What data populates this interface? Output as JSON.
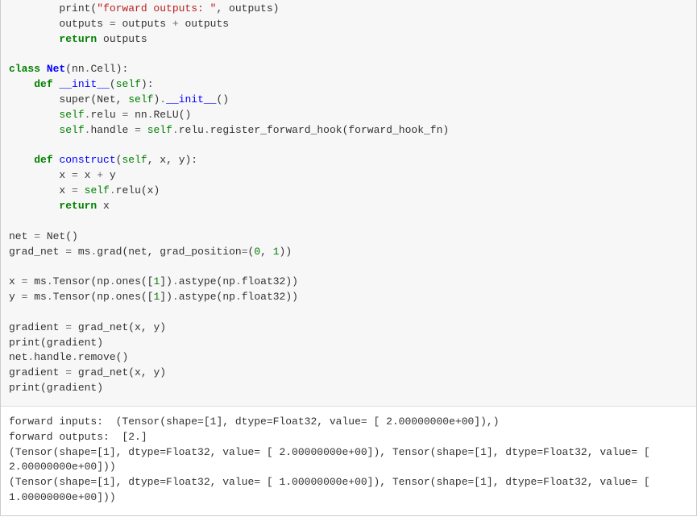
{
  "code": {
    "l0a": "        print(",
    "l0s": "\"forward outputs: \"",
    "l0b": ", outputs)",
    "l1a": "        outputs ",
    "l1op": "=",
    "l1b": " outputs ",
    "l1op2": "+",
    "l1c": " outputs",
    "l2a": "        ",
    "l2kw": "return",
    "l2b": " outputs",
    "l4kw": "class",
    "l4sp": " ",
    "l4cls": "Net",
    "l4a": "(nn",
    "l4op": ".",
    "l4b": "Cell):",
    "l5a": "    ",
    "l5kw": "def",
    "l5sp": " ",
    "l5fn": "__init__",
    "l5b": "(",
    "l5self": "self",
    "l5c": "):",
    "l6a": "        super(Net, ",
    "l6self": "self",
    "l6b": ")",
    "l6op": ".",
    "l6fn": "__init__",
    "l6c": "()",
    "l7a": "        ",
    "l7self": "self",
    "l7op": ".",
    "l7b": "relu ",
    "l7op2": "=",
    "l7c": " nn",
    "l7op3": ".",
    "l7d": "ReLU()",
    "l8a": "        ",
    "l8self": "self",
    "l8op": ".",
    "l8b": "handle ",
    "l8op2": "=",
    "l8c": " ",
    "l8self2": "self",
    "l8op3": ".",
    "l8d": "relu",
    "l8op4": ".",
    "l8e": "register_forward_hook(forward_hook_fn)",
    "l10a": "    ",
    "l10kw": "def",
    "l10sp": " ",
    "l10fn": "construct",
    "l10b": "(",
    "l10self": "self",
    "l10c": ", x, y):",
    "l11a": "        x ",
    "l11op": "=",
    "l11b": " x ",
    "l11op2": "+",
    "l11c": " y",
    "l12a": "        x ",
    "l12op": "=",
    "l12b": " ",
    "l12self": "self",
    "l12op2": ".",
    "l12c": "relu(x)",
    "l13a": "        ",
    "l13kw": "return",
    "l13b": " x",
    "l15a": "net ",
    "l15op": "=",
    "l15b": " Net()",
    "l16a": "grad_net ",
    "l16op": "=",
    "l16b": " ms",
    "l16op2": ".",
    "l16c": "grad(net, grad_position",
    "l16op3": "=",
    "l16d": "(",
    "l16n1": "0",
    "l16e": ", ",
    "l16n2": "1",
    "l16f": "))",
    "l18a": "x ",
    "l18op": "=",
    "l18b": " ms",
    "l18op2": ".",
    "l18c": "Tensor(np",
    "l18op3": ".",
    "l18d": "ones([",
    "l18n": "1",
    "l18e": "])",
    "l18op4": ".",
    "l18f": "astype(np",
    "l18op5": ".",
    "l18g": "float32))",
    "l19a": "y ",
    "l19op": "=",
    "l19b": " ms",
    "l19op2": ".",
    "l19c": "Tensor(np",
    "l19op3": ".",
    "l19d": "ones([",
    "l19n": "1",
    "l19e": "])",
    "l19op4": ".",
    "l19f": "astype(np",
    "l19op5": ".",
    "l19g": "float32))",
    "l21a": "gradient ",
    "l21op": "=",
    "l21b": " grad_net(x, y)",
    "l22a": "print(gradient)",
    "l23a": "net",
    "l23op": ".",
    "l23b": "handle",
    "l23op2": ".",
    "l23c": "remove()",
    "l24a": "gradient ",
    "l24op": "=",
    "l24b": " grad_net(x, y)",
    "l25a": "print(gradient)"
  },
  "output": {
    "line1": "forward inputs:  (Tensor(shape=[1], dtype=Float32, value= [ 2.00000000e+00]),)",
    "line2": "forward outputs:  [2.]",
    "line3": "(Tensor(shape=[1], dtype=Float32, value= [ 2.00000000e+00]), Tensor(shape=[1], dtype=Float32, value= [ 2.00000000e+00]))",
    "line4": "(Tensor(shape=[1], dtype=Float32, value= [ 1.00000000e+00]), Tensor(shape=[1], dtype=Float32, value= [ 1.00000000e+00]))"
  }
}
